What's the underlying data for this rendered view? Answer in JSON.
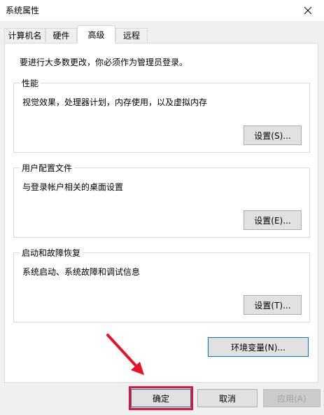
{
  "window": {
    "title": "系统属性"
  },
  "tabs": [
    {
      "label": "计算机名"
    },
    {
      "label": "硬件"
    },
    {
      "label": "高级"
    },
    {
      "label": "远程"
    }
  ],
  "note": "要进行大多数更改，你必须作为管理员登录。",
  "groups": {
    "performance": {
      "title": "性能",
      "desc": "视觉效果，处理器计划，内存使用，以及虚拟内存",
      "button": "设置(S)..."
    },
    "profiles": {
      "title": "用户配置文件",
      "desc": "与登录帐户相关的桌面设置",
      "button": "设置(E)..."
    },
    "startup": {
      "title": "启动和故障恢复",
      "desc": "系统启动、系统故障和调试信息",
      "button": "设置(T)..."
    }
  },
  "env_button": "环境变量(N)...",
  "footer": {
    "ok": "确定",
    "cancel": "取消",
    "apply": "应用(A)"
  },
  "colors": {
    "annotation_red": "#e8132b",
    "focus_blue": "#0078d7"
  }
}
